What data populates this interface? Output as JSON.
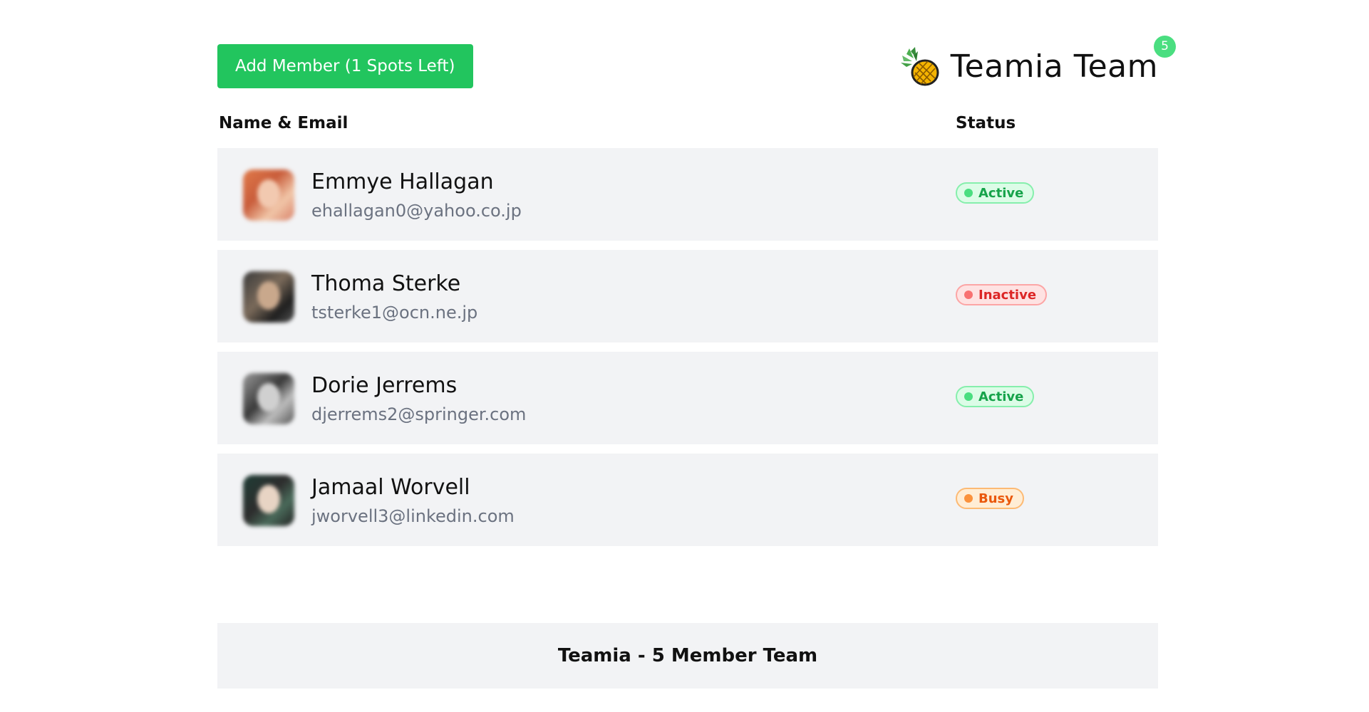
{
  "header": {
    "add_button_label": "Add Member (1 Spots Left)",
    "team_title": "Teamia Team",
    "team_badge_count": "5",
    "logo_icon": "pineapple-icon",
    "accent_color": "#22c55e"
  },
  "columns": {
    "name_email": "Name & Email",
    "status": "Status"
  },
  "members": [
    {
      "name": "Emmye Hallagan",
      "email": "ehallagan0@yahoo.co.jp",
      "status": "Active",
      "status_color": "#22c55e"
    },
    {
      "name": "Thoma Sterke",
      "email": "tsterke1@ocn.ne.jp",
      "status": "Inactive",
      "status_color": "#ef4444"
    },
    {
      "name": "Dorie Jerrems",
      "email": "djerrems2@springer.com",
      "status": "Active",
      "status_color": "#22c55e"
    },
    {
      "name": "Jamaal Worvell",
      "email": "jworvell3@linkedin.com",
      "status": "Busy",
      "status_color": "#f97316"
    }
  ],
  "footer": {
    "text": "Teamia - 5 Member Team"
  }
}
